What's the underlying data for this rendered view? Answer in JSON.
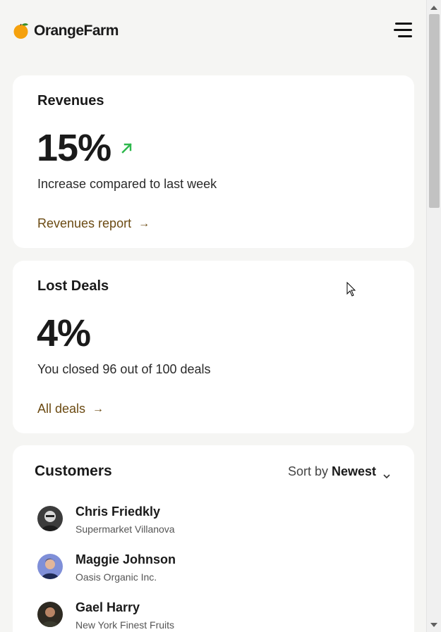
{
  "brand": {
    "name": "OrangeFarm"
  },
  "colors": {
    "accent_link": "#6b4a12",
    "trend_up": "#2db84c",
    "orange": "#f39c12"
  },
  "revenues": {
    "title": "Revenues",
    "value": "15%",
    "trend": "up",
    "description": "Increase compared to last week",
    "link_label": "Revenues report",
    "link_arrow": "→"
  },
  "lost_deals": {
    "title": "Lost Deals",
    "value": "4%",
    "description": "You closed 96 out of 100 deals",
    "link_label": "All deals",
    "link_arrow": "→"
  },
  "customers": {
    "title": "Customers",
    "sort_prefix": "Sort by",
    "sort_value": "Newest",
    "items": [
      {
        "name": "Chris Friedkly",
        "company": "Supermarket Villanova"
      },
      {
        "name": "Maggie Johnson",
        "company": "Oasis Organic Inc."
      },
      {
        "name": "Gael Harry",
        "company": "New York Finest Fruits"
      }
    ]
  },
  "icons": {
    "logo": "orange-fruit-icon",
    "menu": "hamburger-menu-icon",
    "trend": "arrow-up-right-icon",
    "sort": "chevron-down-icon"
  }
}
